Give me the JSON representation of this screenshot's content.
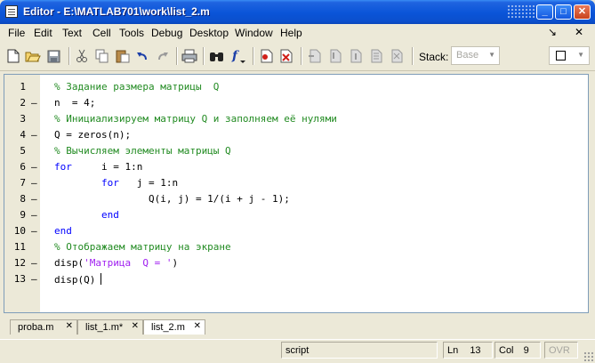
{
  "window": {
    "title": "Editor - E:\\MATLAB701\\work\\list_2.m",
    "minimize_glyph": "_",
    "maximize_glyph": "□",
    "close_glyph": "✕"
  },
  "menu": {
    "items": [
      "File",
      "Edit",
      "Text",
      "Cell",
      "Tools",
      "Debug",
      "Desktop",
      "Window",
      "Help"
    ],
    "undock_glyph": "↘",
    "close_doc_glyph": "✕"
  },
  "toolbar": {
    "icons": [
      "new-file-icon",
      "open-folder-icon",
      "save-icon",
      "cut-icon",
      "copy-icon",
      "paste-icon",
      "undo-icon",
      "redo-icon",
      "print-icon",
      "find-icon",
      "function-icon",
      "set-breakpoint-icon",
      "clear-breakpoint-icon",
      "step-icon",
      "step-in-icon",
      "step-out-icon",
      "continue-icon",
      "exit-debug-icon"
    ],
    "stack_label": "Stack:",
    "stack_value": "Base"
  },
  "editor": {
    "lines": [
      {
        "no": "1",
        "dash": "",
        "tokens": [
          {
            "t": "% Задание размера матрицы  Q",
            "c": "comment"
          }
        ]
      },
      {
        "no": "2",
        "dash": "–",
        "tokens": [
          {
            "t": "n  = 4;",
            "c": "plain"
          }
        ]
      },
      {
        "no": "3",
        "dash": "",
        "tokens": [
          {
            "t": "% Инициализируем матрицу Q и заполняем её нулями",
            "c": "comment"
          }
        ]
      },
      {
        "no": "4",
        "dash": "–",
        "tokens": [
          {
            "t": "Q = zeros(n);",
            "c": "plain"
          }
        ]
      },
      {
        "no": "5",
        "dash": "",
        "tokens": [
          {
            "t": "% Вычисляем элементы матрицы Q",
            "c": "comment"
          }
        ]
      },
      {
        "no": "6",
        "dash": "–",
        "tokens": [
          {
            "t": "for",
            "c": "keyword"
          },
          {
            "t": "     i = 1:n",
            "c": "plain"
          }
        ]
      },
      {
        "no": "7",
        "dash": "–",
        "tokens": [
          {
            "t": "        ",
            "c": "plain"
          },
          {
            "t": "for",
            "c": "keyword"
          },
          {
            "t": "   j = 1:n",
            "c": "plain"
          }
        ]
      },
      {
        "no": "8",
        "dash": "–",
        "tokens": [
          {
            "t": "                Q(i, j) = 1/(i + j - 1);",
            "c": "plain"
          }
        ]
      },
      {
        "no": "9",
        "dash": "–",
        "tokens": [
          {
            "t": "        ",
            "c": "plain"
          },
          {
            "t": "end",
            "c": "keyword"
          }
        ]
      },
      {
        "no": "10",
        "dash": "–",
        "tokens": [
          {
            "t": "end",
            "c": "keyword"
          }
        ]
      },
      {
        "no": "11",
        "dash": "",
        "tokens": [
          {
            "t": "% Отображаем матрицу на экране",
            "c": "comment"
          }
        ]
      },
      {
        "no": "12",
        "dash": "–",
        "tokens": [
          {
            "t": "disp(",
            "c": "plain"
          },
          {
            "t": "'Матрица  Q = '",
            "c": "string"
          },
          {
            "t": ")",
            "c": "plain"
          }
        ]
      },
      {
        "no": "13",
        "dash": "–",
        "tokens": [
          {
            "t": "disp(Q)",
            "c": "plain"
          }
        ],
        "caret": true
      }
    ],
    "colors": {
      "comment": "#228b22",
      "keyword": "#0000ff",
      "string": "#a020f0"
    }
  },
  "tabs": [
    {
      "label": "proba.m",
      "close": "✕",
      "active": false
    },
    {
      "label": "list_1.m*",
      "close": "✕",
      "active": false
    },
    {
      "label": "list_2.m",
      "close": "✕",
      "active": true
    }
  ],
  "status": {
    "mode": "script",
    "ln_label": "Ln",
    "ln_value": "13",
    "col_label": "Col",
    "col_value": "9",
    "ovr": "OVR"
  }
}
